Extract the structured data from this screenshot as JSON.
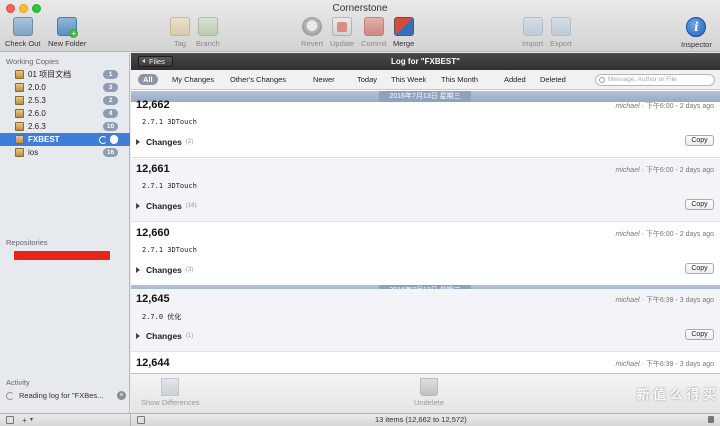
{
  "window": {
    "title": "Cornerstone"
  },
  "toolbar": {
    "checkout_label": "Check Out",
    "new_folder_label": "New Folder",
    "tag_label": "Tag",
    "branch_label": "Branch",
    "revert_label": "Revert",
    "update_label": "Update",
    "commit_label": "Commit",
    "merge_label": "Merge",
    "import_label": "Import",
    "export_label": "Export",
    "inspector_label": "Inspector",
    "inspector_glyph": "i"
  },
  "sidebar": {
    "working_copies_title": "Working Copies",
    "items": [
      {
        "label": "01 项目文档",
        "badge": "1"
      },
      {
        "label": "2.0.0",
        "badge": "3"
      },
      {
        "label": "2.5.3",
        "badge": "2"
      },
      {
        "label": "2.6.0",
        "badge": "4"
      },
      {
        "label": "2.6.3",
        "badge": "10"
      },
      {
        "label": "FXBEST",
        "badge": ""
      },
      {
        "label": "ios",
        "badge": "16"
      }
    ],
    "selected_index": 5,
    "repositories_title": "Repositories",
    "activity_title": "Activity",
    "activity_text": "Reading log for \"FXBes...",
    "add_label": "+",
    "menu_label": "▾"
  },
  "log": {
    "files_button": "Files",
    "title": "Log for \"FXBEST\"",
    "filters": [
      "All",
      "My Changes",
      "Other's Changes",
      "Newer",
      "Today",
      "This Week",
      "This Month",
      "Added",
      "Deleted"
    ],
    "search_placeholder": "Message, Author or File",
    "date_separators": [
      "2016年7月13日 星期三",
      "2016年7月12日 星期二"
    ],
    "entries": [
      {
        "revision": "12,662",
        "author": "michael",
        "time": "下午6:00",
        "ago": "2 days ago",
        "message": "2.7.1 3DTouch",
        "changes_label": "Changes",
        "changes_count": "(2)",
        "copy_label": "Copy"
      },
      {
        "revision": "12,661",
        "author": "michael",
        "time": "下午6:00",
        "ago": "2 days ago",
        "message": "2.7.1 3DTouch",
        "changes_label": "Changes",
        "changes_count": "(16)",
        "copy_label": "Copy"
      },
      {
        "revision": "12,660",
        "author": "michael",
        "time": "下午6:00",
        "ago": "2 days ago",
        "message": "2.7.1 3DTouch",
        "changes_label": "Changes",
        "changes_count": "(3)",
        "copy_label": "Copy"
      },
      {
        "revision": "12,645",
        "author": "michael",
        "time": "下午6:39",
        "ago": "3 days ago",
        "message": "2.7.0 优化",
        "changes_label": "Changes",
        "changes_count": "(1)",
        "copy_label": "Copy"
      },
      {
        "revision": "12,644",
        "author": "michael",
        "time": "下午6:39",
        "ago": "3 days ago",
        "message": "",
        "changes_label": "",
        "changes_count": "",
        "copy_label": ""
      }
    ]
  },
  "bottom": {
    "show_differences_label": "Show Differences",
    "undelete_label": "Undelete",
    "right_label": "D",
    "status_text": "13 items (12,662 to 12,572)"
  },
  "watermark": {
    "text": "新 值 么 得 买"
  }
}
